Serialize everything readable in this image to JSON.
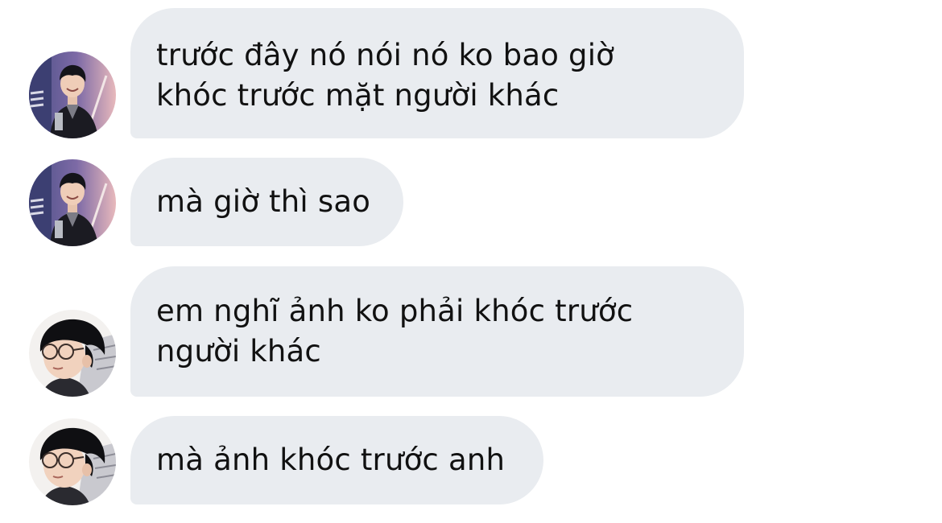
{
  "conversation": {
    "messages": [
      {
        "sender": "a",
        "text": "trước đây nó nói nó ko bao giờ\nkhóc trước mặt người khác"
      },
      {
        "sender": "a",
        "text": "mà giờ thì sao"
      },
      {
        "sender": "b",
        "text": "em nghĩ ảnh ko phải khóc trước\nngười khác"
      },
      {
        "sender": "b",
        "text": "mà ảnh khóc trước anh"
      }
    ]
  },
  "colors": {
    "bubble_background": "#e9ecf0",
    "text": "#111111",
    "page_background": "#ffffff"
  }
}
